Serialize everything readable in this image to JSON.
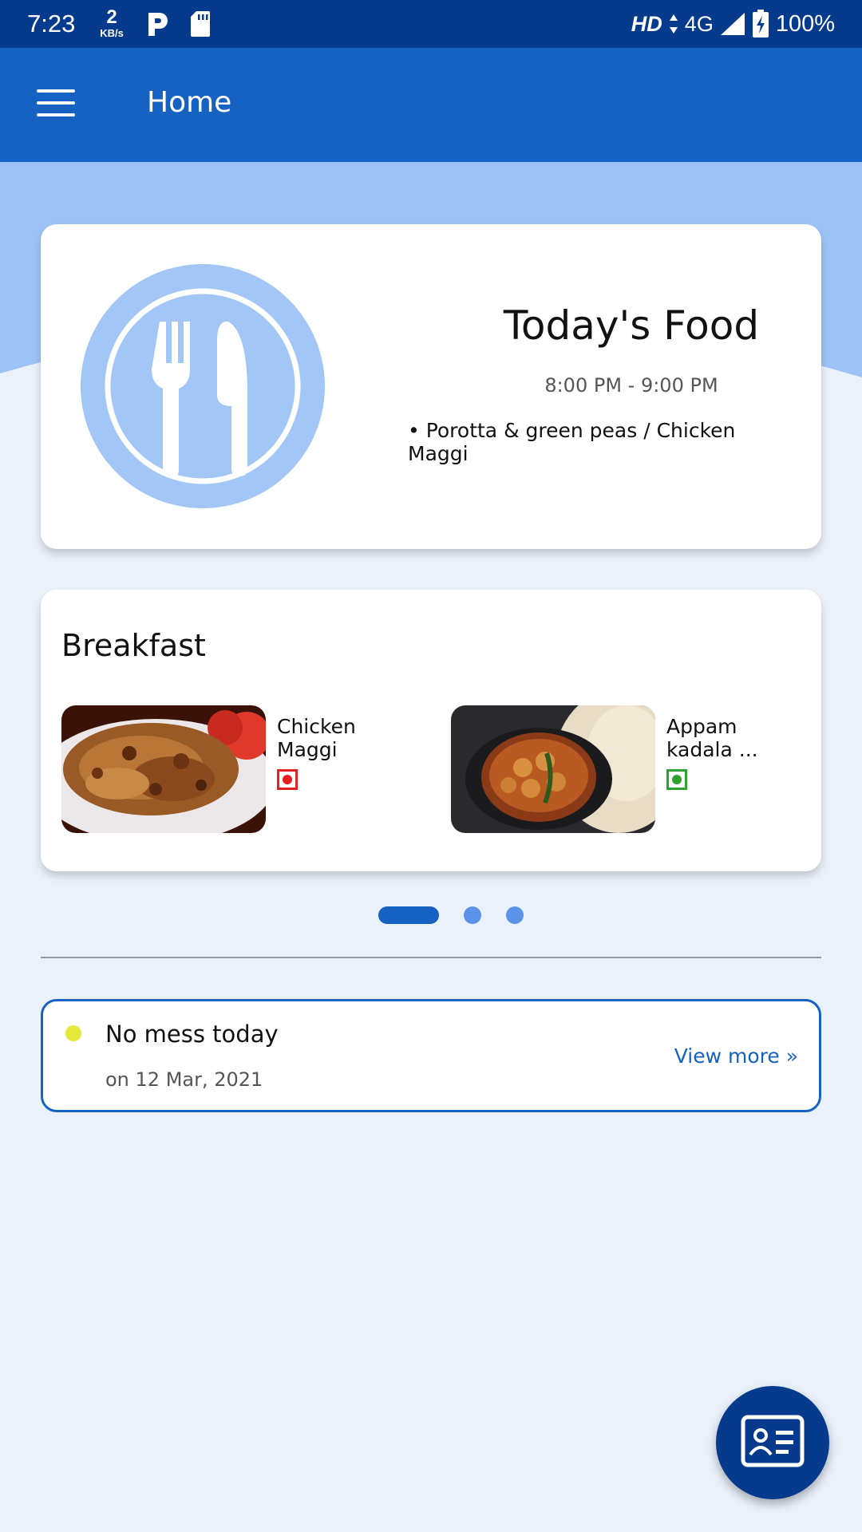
{
  "status_bar": {
    "time": "7:23",
    "net_speed_value": "2",
    "net_speed_unit": "KB/s",
    "hd_label": "HD",
    "network_label": "4G",
    "battery_percent": "100%"
  },
  "app_bar": {
    "menu_icon": "hamburger-menu-icon",
    "title": "Home",
    "color": "#1662c2"
  },
  "todays_food": {
    "icon": "fork-knife-plate-icon",
    "title": "Today's Food",
    "time": "8:00 PM - 9:00 PM",
    "items": "• Porotta & green peas / Chicken Maggi"
  },
  "breakfast": {
    "title": "Breakfast",
    "dishes": [
      {
        "name": "Chicken Maggi",
        "type": "non-veg",
        "mark_color": "#e52020"
      },
      {
        "name": "Appam kadala ...",
        "type": "veg",
        "mark_color": "#2ea32e"
      }
    ]
  },
  "pager": {
    "count": 3,
    "active_index": 0,
    "active_color": "#1662c2",
    "inactive_color": "#5b93ea"
  },
  "notice": {
    "status_color": "#e5ea3a",
    "title": "No mess today",
    "date": "on 12 Mar, 2021",
    "action_label": "View more »"
  },
  "fab": {
    "icon": "id-card-icon"
  }
}
